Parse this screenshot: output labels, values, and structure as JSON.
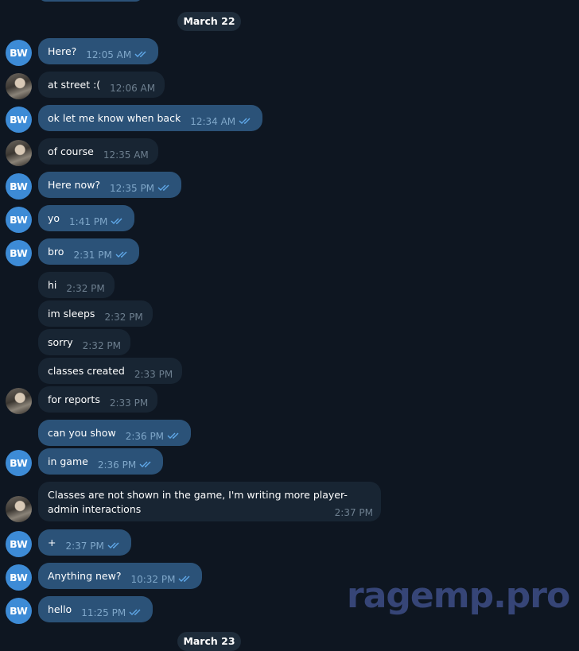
{
  "dates": {
    "top": "March 22",
    "bottom": "March 23"
  },
  "watermark": "ragemp.pro",
  "avatars": {
    "bw": "BW"
  },
  "colors": {
    "background": "#0e1621",
    "outgoing": "#2b5278",
    "incoming": "#182533",
    "avatar_bw": "#3d8bd6",
    "check": "#5fa8e8"
  },
  "messages": [
    {
      "sender": "BW",
      "text": "Here?",
      "time": "12:05 AM",
      "read": true
    },
    {
      "sender": "photo",
      "text": "at street :(",
      "time": "12:06 AM"
    },
    {
      "sender": "BW",
      "text": "ok let me know when back",
      "time": "12:34 AM",
      "read": true
    },
    {
      "sender": "photo",
      "text": "of course",
      "time": "12:35 AM"
    },
    {
      "sender": "BW",
      "text": "Here now?",
      "time": "12:35 PM",
      "read": true
    },
    {
      "sender": "BW",
      "text": "yo",
      "time": "1:41 PM",
      "read": true
    },
    {
      "sender": "BW",
      "text": "bro",
      "time": "2:31 PM",
      "read": true
    },
    {
      "sender": "photo",
      "text": "hi",
      "time": "2:32 PM"
    },
    {
      "sender": "photo",
      "text": "im sleeps",
      "time": "2:32 PM"
    },
    {
      "sender": "photo",
      "text": "sorry",
      "time": "2:32 PM"
    },
    {
      "sender": "photo",
      "text": "classes created",
      "time": "2:33 PM"
    },
    {
      "sender": "photo",
      "text": "for reports",
      "time": "2:33 PM"
    },
    {
      "sender": "BW",
      "text": "can you show",
      "time": "2:36 PM",
      "read": true
    },
    {
      "sender": "BW",
      "text": "in game",
      "time": "2:36 PM",
      "read": true
    },
    {
      "sender": "photo",
      "text": "Classes are not shown in the game, I'm writing more player-admin interactions",
      "time": "2:37 PM"
    },
    {
      "sender": "BW",
      "text": "+",
      "time": "2:37 PM",
      "read": true
    },
    {
      "sender": "BW",
      "text": "Anything new?",
      "time": "10:32 PM",
      "read": true
    },
    {
      "sender": "BW",
      "text": "hello",
      "time": "11:25 PM",
      "read": true
    }
  ]
}
